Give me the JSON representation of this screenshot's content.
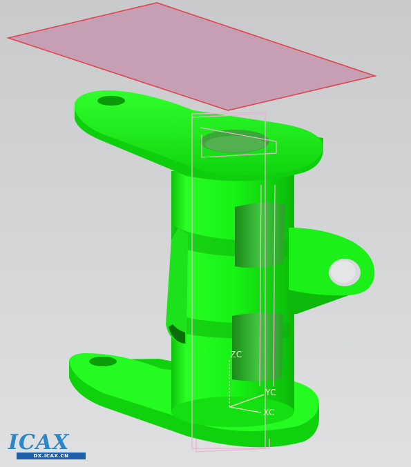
{
  "viewport": {
    "background_top": "#c9cacb",
    "background_bottom": "#dfe0e1"
  },
  "model": {
    "part_color": "#15f012",
    "part_shadow": "#0c8f0a",
    "datum_plane_fill": "#c79bb2",
    "datum_plane_edge": "#e0444c",
    "wcs_color": "#e7b4d0"
  },
  "wcs_axes": {
    "zc": "ZC",
    "yc": "YC",
    "xc": "XC"
  },
  "watermark": {
    "logo_text": "ICAX",
    "sub_text": "DX.ICAX.CN",
    "logo_color": "#2b86c9"
  }
}
